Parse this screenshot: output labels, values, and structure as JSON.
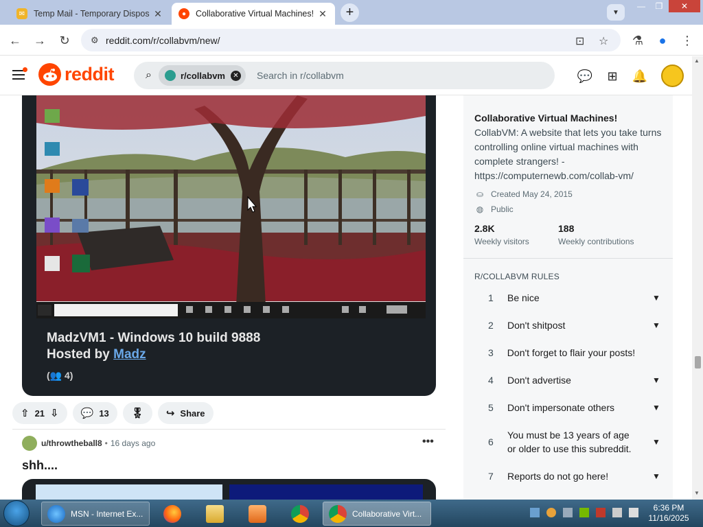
{
  "browser": {
    "tabs": [
      {
        "title": "Temp Mail - Temporary Dispos",
        "active": false
      },
      {
        "title": "Collaborative Virtual Machines!",
        "active": true
      }
    ],
    "url": "reddit.com/r/collabvm/new/",
    "icons": [
      "back-icon",
      "forward-icon",
      "reload-icon",
      "site-info-icon",
      "install-icon",
      "star-icon",
      "labs-icon",
      "profile-icon",
      "menu-icon"
    ]
  },
  "header": {
    "brand": "reddit",
    "search_chip": "r/collabvm",
    "search_placeholder": "Search in r/collabvm"
  },
  "feed": {
    "post1": {
      "vm_title": "MadzVM1 - Windows 10 build 9888",
      "hosted_prefix": "Hosted by ",
      "host": "Madz",
      "users": "(👥 4)",
      "votes": "21",
      "comments": "13",
      "share": "Share"
    },
    "post2": {
      "author": "u/throwtheball8",
      "separator": "•",
      "age": "16 days ago",
      "more": "•••",
      "title": "shh...."
    }
  },
  "sidebar": {
    "title": "Collaborative Virtual Machines!",
    "description": "CollabVM: A website that lets you take turns controlling online virtual machines with complete strangers! - https://computernewb.com/collab-vm/",
    "created": "Created May 24, 2015",
    "visibility": "Public",
    "stats": [
      {
        "value": "2.8K",
        "label": "Weekly visitors"
      },
      {
        "value": "188",
        "label": "Weekly contributions"
      }
    ],
    "rules_heading": "R/COLLABVM RULES",
    "rules": [
      {
        "num": "1",
        "text": "Be nice",
        "expandable": true
      },
      {
        "num": "2",
        "text": "Don't shitpost",
        "expandable": true
      },
      {
        "num": "3",
        "text": "Don't forget to flair your posts!",
        "expandable": false
      },
      {
        "num": "4",
        "text": "Don't advertise",
        "expandable": true
      },
      {
        "num": "5",
        "text": "Don't impersonate others",
        "expandable": true
      },
      {
        "num": "6",
        "text": "You must be 13 years of age or older to use this subreddit.",
        "expandable": true
      },
      {
        "num": "7",
        "text": "Reports do not go here!",
        "expandable": true
      }
    ]
  },
  "taskbar": {
    "items": [
      {
        "label": "MSN - Internet Ex...",
        "icon": "ie-icon"
      },
      {
        "label": "",
        "icon": "firefox-icon"
      },
      {
        "label": "",
        "icon": "folder-icon"
      },
      {
        "label": "",
        "icon": "media-player-icon"
      },
      {
        "label": "",
        "icon": "chrome-icon"
      },
      {
        "label": "Collaborative Virt...",
        "icon": "chrome-icon"
      }
    ],
    "time": "6:36 PM",
    "date": "11/16/2025"
  },
  "colors": {
    "reddit_orange": "#ff4500",
    "tab_strip": "#b9c8e3",
    "sidebar_bg": "#f6f7f8"
  }
}
